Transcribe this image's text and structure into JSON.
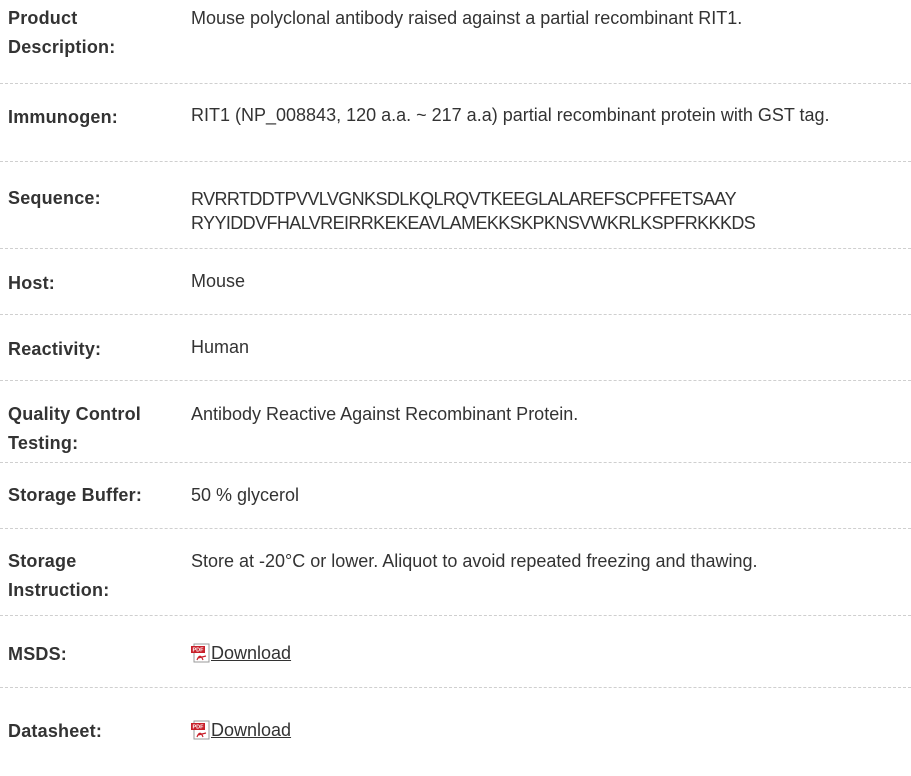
{
  "rows": [
    {
      "label": "Product Description:",
      "value": "Mouse polyclonal antibody raised against a partial recombinant RIT1."
    },
    {
      "label": "Immunogen:",
      "value": "RIT1 (NP_008843, 120 a.a. ~ 217 a.a) partial recombinant protein with GST tag."
    },
    {
      "label": "Sequence:",
      "value_line1": "RVRRTDDTPVVLVGNKSDLKQLRQVTKEEGLALAREFSCPFFETSAAY",
      "value_line2": "RYYIDDVFHALVREIRRKEKEAVLAMEKKSKPKNSVWKRLKSPFRKKKDS"
    },
    {
      "label": "Host:",
      "value": "Mouse"
    },
    {
      "label": "Reactivity:",
      "value": "Human"
    },
    {
      "label": "Quality Control Testing:",
      "value": "Antibody Reactive Against Recombinant Protein."
    },
    {
      "label": "Storage Buffer:",
      "value": "50 % glycerol"
    },
    {
      "label": "Storage Instruction:",
      "value": "Store at -20°C or lower. Aliquot to avoid repeated freezing and thawing."
    },
    {
      "label": "MSDS:",
      "link_text": "Download",
      "icon": "pdf-icon"
    },
    {
      "label": "Datasheet:",
      "link_text": "Download",
      "icon": "pdf-icon"
    }
  ],
  "colors": {
    "text": "#333333",
    "divider": "#cfcfcf",
    "pdf_red": "#c8202a"
  }
}
